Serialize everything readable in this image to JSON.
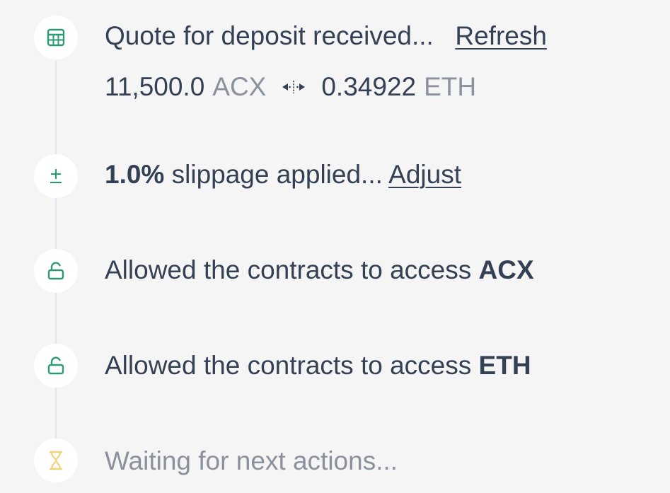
{
  "steps": [
    {
      "icon": "calculator-icon",
      "text": "Quote for deposit received...",
      "link": "Refresh"
    },
    {
      "icon": "plus-minus-icon",
      "bold": "1.0%",
      "text": "slippage applied...",
      "link": "Adjust"
    },
    {
      "icon": "unlock-icon",
      "text": "Allowed the contracts to access",
      "bold": "ACX"
    },
    {
      "icon": "unlock-icon",
      "text": "Allowed the contracts to access",
      "bold": "ETH"
    },
    {
      "icon": "hourglass-icon",
      "text": "Waiting for next actions..."
    }
  ],
  "quote": {
    "from_amount": "11,500.0",
    "from_token": "ACX",
    "to_amount": "0.34922",
    "to_token": "ETH"
  },
  "colors": {
    "background": "#f5f5f5",
    "text": "#344054",
    "muted": "#8b919c",
    "accent_green": "#2c9b73",
    "pending_yellow": "#f3d27a",
    "connector": "#e3e6ee"
  }
}
